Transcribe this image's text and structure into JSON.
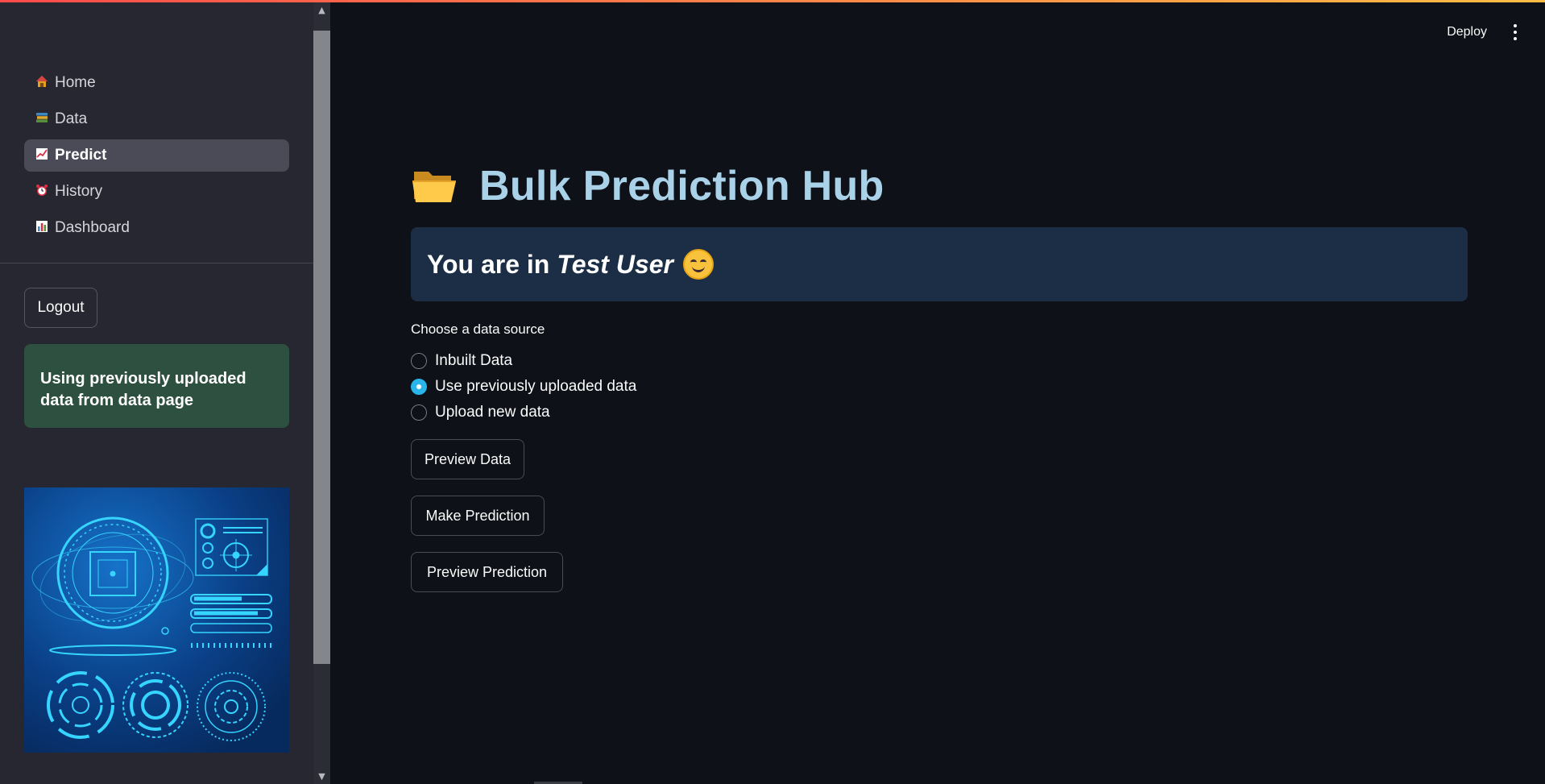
{
  "sidebar": {
    "nav": [
      {
        "label": "Home",
        "icon": "home-icon"
      },
      {
        "label": "Data",
        "icon": "books-icon"
      },
      {
        "label": "Predict",
        "icon": "chart-increasing-icon",
        "active": true
      },
      {
        "label": "History",
        "icon": "alarm-clock-icon"
      },
      {
        "label": "Dashboard",
        "icon": "bar-chart-icon"
      }
    ],
    "logout_label": "Logout",
    "status_message": "Using previously uploaded data from data page"
  },
  "header": {
    "deploy_label": "Deploy"
  },
  "main": {
    "title": "Bulk Prediction Hub",
    "title_icon": "open-folder-icon",
    "info_prefix": "You are in",
    "info_user": "Test User",
    "info_emoji": "smiling-face-icon",
    "radio_label": "Choose a data source",
    "radio_options": [
      "Inbuilt Data",
      "Use previously uploaded data",
      "Upload new data"
    ],
    "radio_selected": "Use previously uploaded data",
    "buttons": {
      "preview_data": "Preview Data",
      "make_prediction": "Make Prediction",
      "preview_prediction": "Preview Prediction"
    }
  },
  "colors": {
    "accent": "#29b5e8",
    "title": "#a9d1e8",
    "info_bg": "#1b2e45",
    "success_bg": "#2e5040",
    "sidebar_bg": "#262730",
    "app_bg": "#0e1117"
  }
}
